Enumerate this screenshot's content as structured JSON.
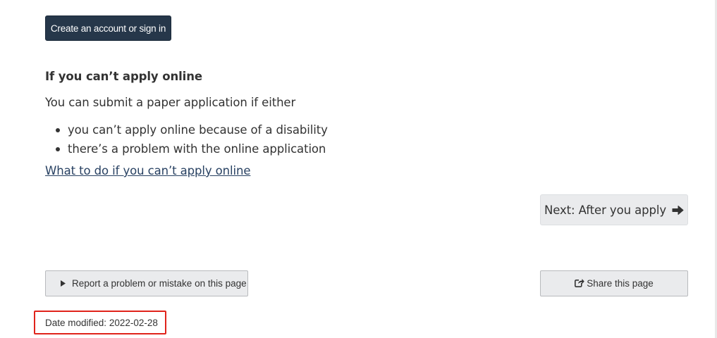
{
  "actions": {
    "signin_label": "Create an account or sign in"
  },
  "offline": {
    "heading": "If you can’t apply online",
    "intro": "You can submit a paper application if either",
    "bullets": [
      "you can’t apply online because of a disability",
      "there’s a problem with the online application"
    ],
    "link_text": "What to do if you can’t apply online"
  },
  "pager": {
    "next_label": "Next: After you apply",
    "next_icon": "arrow-right-icon"
  },
  "footer": {
    "report_label": "Report a problem or mistake on this page",
    "report_icon": "caret-right-icon",
    "share_label": "Share this page",
    "share_icon": "share-icon",
    "date_modified_label": "Date modified:",
    "date_modified_value": "2022-02-28"
  },
  "colors": {
    "primary_button": "#26374a",
    "link": "#284162",
    "highlight_box": "#e0231b",
    "secondary_button": "#eaebed"
  }
}
